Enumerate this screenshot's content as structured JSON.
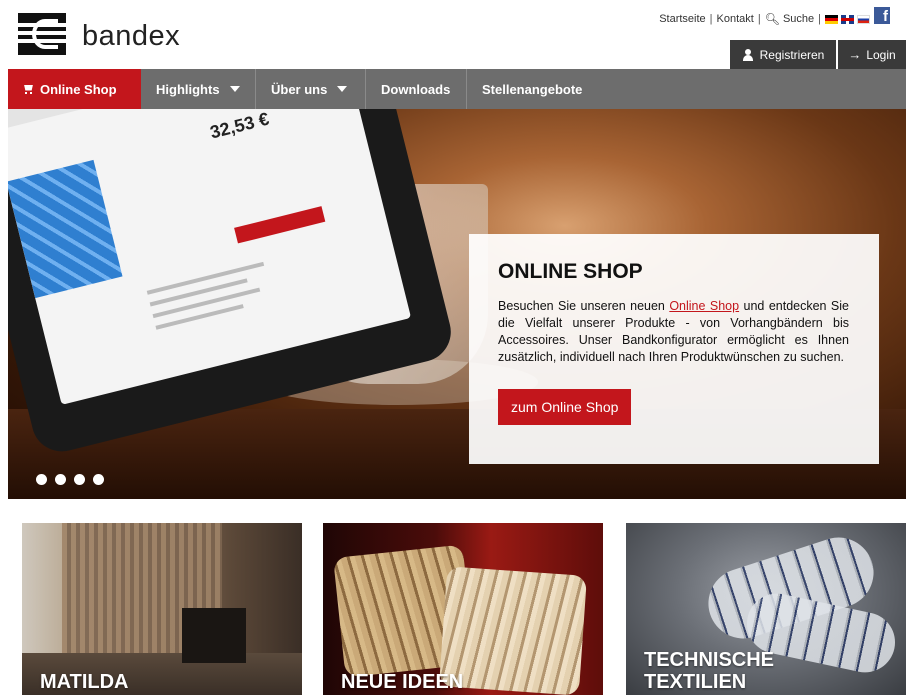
{
  "brand": {
    "name": "bandex"
  },
  "top_links": {
    "home": "Startseite",
    "contact": "Kontakt",
    "search": "Suche",
    "social": "f"
  },
  "auth": {
    "register": "Registrieren",
    "login": "Login"
  },
  "nav": {
    "items": [
      {
        "label": "Online Shop",
        "active": true,
        "icon": "cart-icon"
      },
      {
        "label": "Highlights",
        "dropdown": true
      },
      {
        "label": "Über uns",
        "dropdown": true
      },
      {
        "label": "Downloads"
      },
      {
        "label": "Stellenangebote"
      }
    ]
  },
  "hero": {
    "title": "ONLINE SHOP",
    "text_before": "Besuchen Sie unseren neuen",
    "link": "Online Shop",
    "text_after": "und entdecken Sie die Vielfalt unserer Produkte - von Vorhangbändern bis Accessoires. Unser Bandkonfigurator ermöglicht es Ihnen zusätzlich, individuell nach Ihren Produktwünschen zu suchen.",
    "button": "zum Online Shop",
    "slide_count": 4,
    "tablet_price": "32,53 €"
  },
  "tiles": [
    {
      "label": "MATILDA"
    },
    {
      "label": "NEUE IDEEN"
    },
    {
      "label": "TECHNISCHE TEXTILIEN"
    }
  ],
  "colors": {
    "accent": "#c3161c",
    "nav": "#6d6d6d",
    "auth_button": "#3a3a3a",
    "facebook": "#3b5998"
  }
}
